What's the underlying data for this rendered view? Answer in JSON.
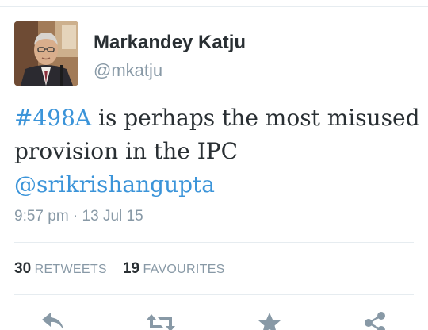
{
  "user": {
    "name": "Markandey Katju",
    "handle": "@mkatju"
  },
  "tweet": {
    "hashtag": "#498A",
    "text_main": " is perhaps the most misused provision in the IPC",
    "mention": "@srikrishangupta",
    "timestamp": "9:57 pm · 13 Jul 15"
  },
  "stats": {
    "retweets_count": "30",
    "retweets_label": "RETWEETS",
    "favourites_count": "19",
    "favourites_label": "FAVOURITES"
  },
  "actions": {
    "icons": [
      "reply-icon",
      "retweet-icon",
      "favourite-icon",
      "share-icon"
    ]
  },
  "colors": {
    "link": "#3b94d9",
    "secondary_text": "#8899a6",
    "icon": "#8899a6",
    "primary_text": "#292f33"
  }
}
